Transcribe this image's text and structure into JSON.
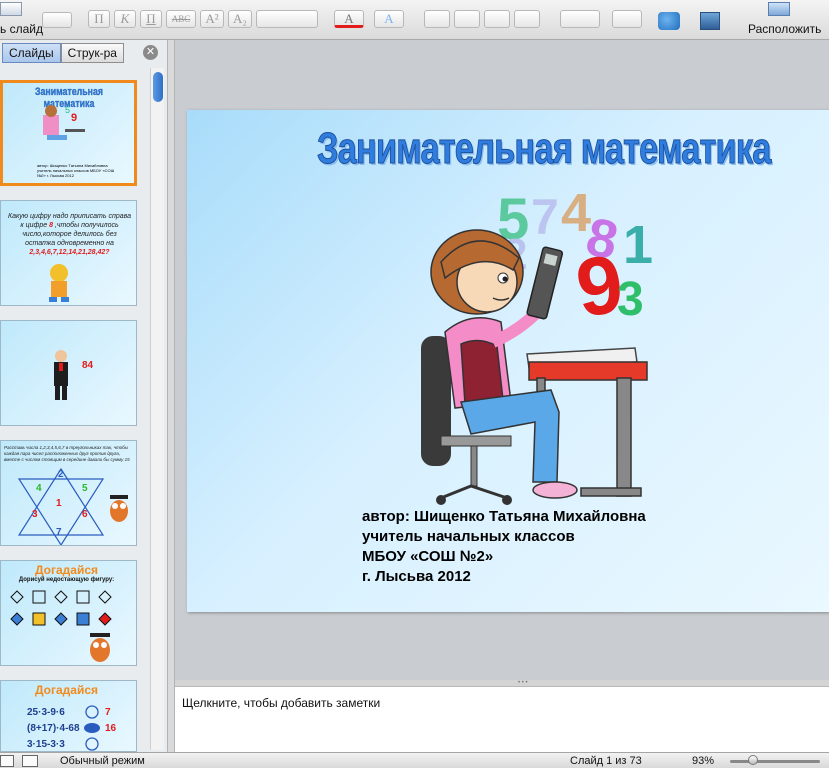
{
  "toolbar": {
    "new_slide_label": "ь слайд",
    "arrange_label": "Расположить",
    "bold": "П",
    "italic": "К",
    "underline": "П",
    "strike": "АВС",
    "superscript": "A²",
    "subscript": "A₂",
    "font_color": "А",
    "text_effect": "A"
  },
  "sidebar": {
    "tabs": [
      "Слайды",
      "Струк-ра"
    ],
    "thumbnails": [
      {
        "title": "Занимательная математика",
        "text": "автор: Шищенко Татьяна Михайловна учитель начальных классов МБОУ «СОШ №2» г. Лысьва 2012"
      },
      {
        "text1": "Какую цифру надо приписать справа к цифре",
        "digit": "8",
        "text2": ",чтобы получилось число,которое делилось без остатка одновременно на",
        "numbers": "2,3,4,6,7,12,14,21,28,42?"
      },
      {
        "number": "84"
      },
      {
        "text": "Расставь числа 1,2,3,4,5,6,7 в треугольниках так, чтобы каждая пара чисел расположенных друг против друга, вместе с числом стоящим в середине давали бы сумму 15",
        "digits": [
          "2",
          "4",
          "5",
          "1",
          "3",
          "6",
          "7"
        ]
      },
      {
        "title": "Догадайся",
        "subtitle": "Дорисуй недостающую фигуру:"
      },
      {
        "title": "Догадайся",
        "rows": [
          "25·3-9·6",
          "(8+17)·4-68",
          "3·15-3·3"
        ],
        "answers": [
          "7",
          "16",
          ""
        ]
      }
    ]
  },
  "slide": {
    "title": "Занимательная математика",
    "author_lines": [
      "автор: Шищенко Татьяна Михайловна",
      "учитель начальных классов",
      "МБОУ «СОШ №2»",
      "г. Лысьва 2012"
    ],
    "floating_digits": [
      "5",
      "7",
      "4",
      "2",
      "8",
      "1",
      "9",
      "3"
    ]
  },
  "notes": {
    "placeholder": "Щелкните, чтобы добавить заметки"
  },
  "status": {
    "mode": "Обычный режим",
    "slide_counter": "Слайд 1 из 73",
    "zoom": "93%"
  },
  "colors": {
    "accent": "#2f7ddf",
    "selection": "#f08a1c",
    "red": "#e21b1b"
  }
}
